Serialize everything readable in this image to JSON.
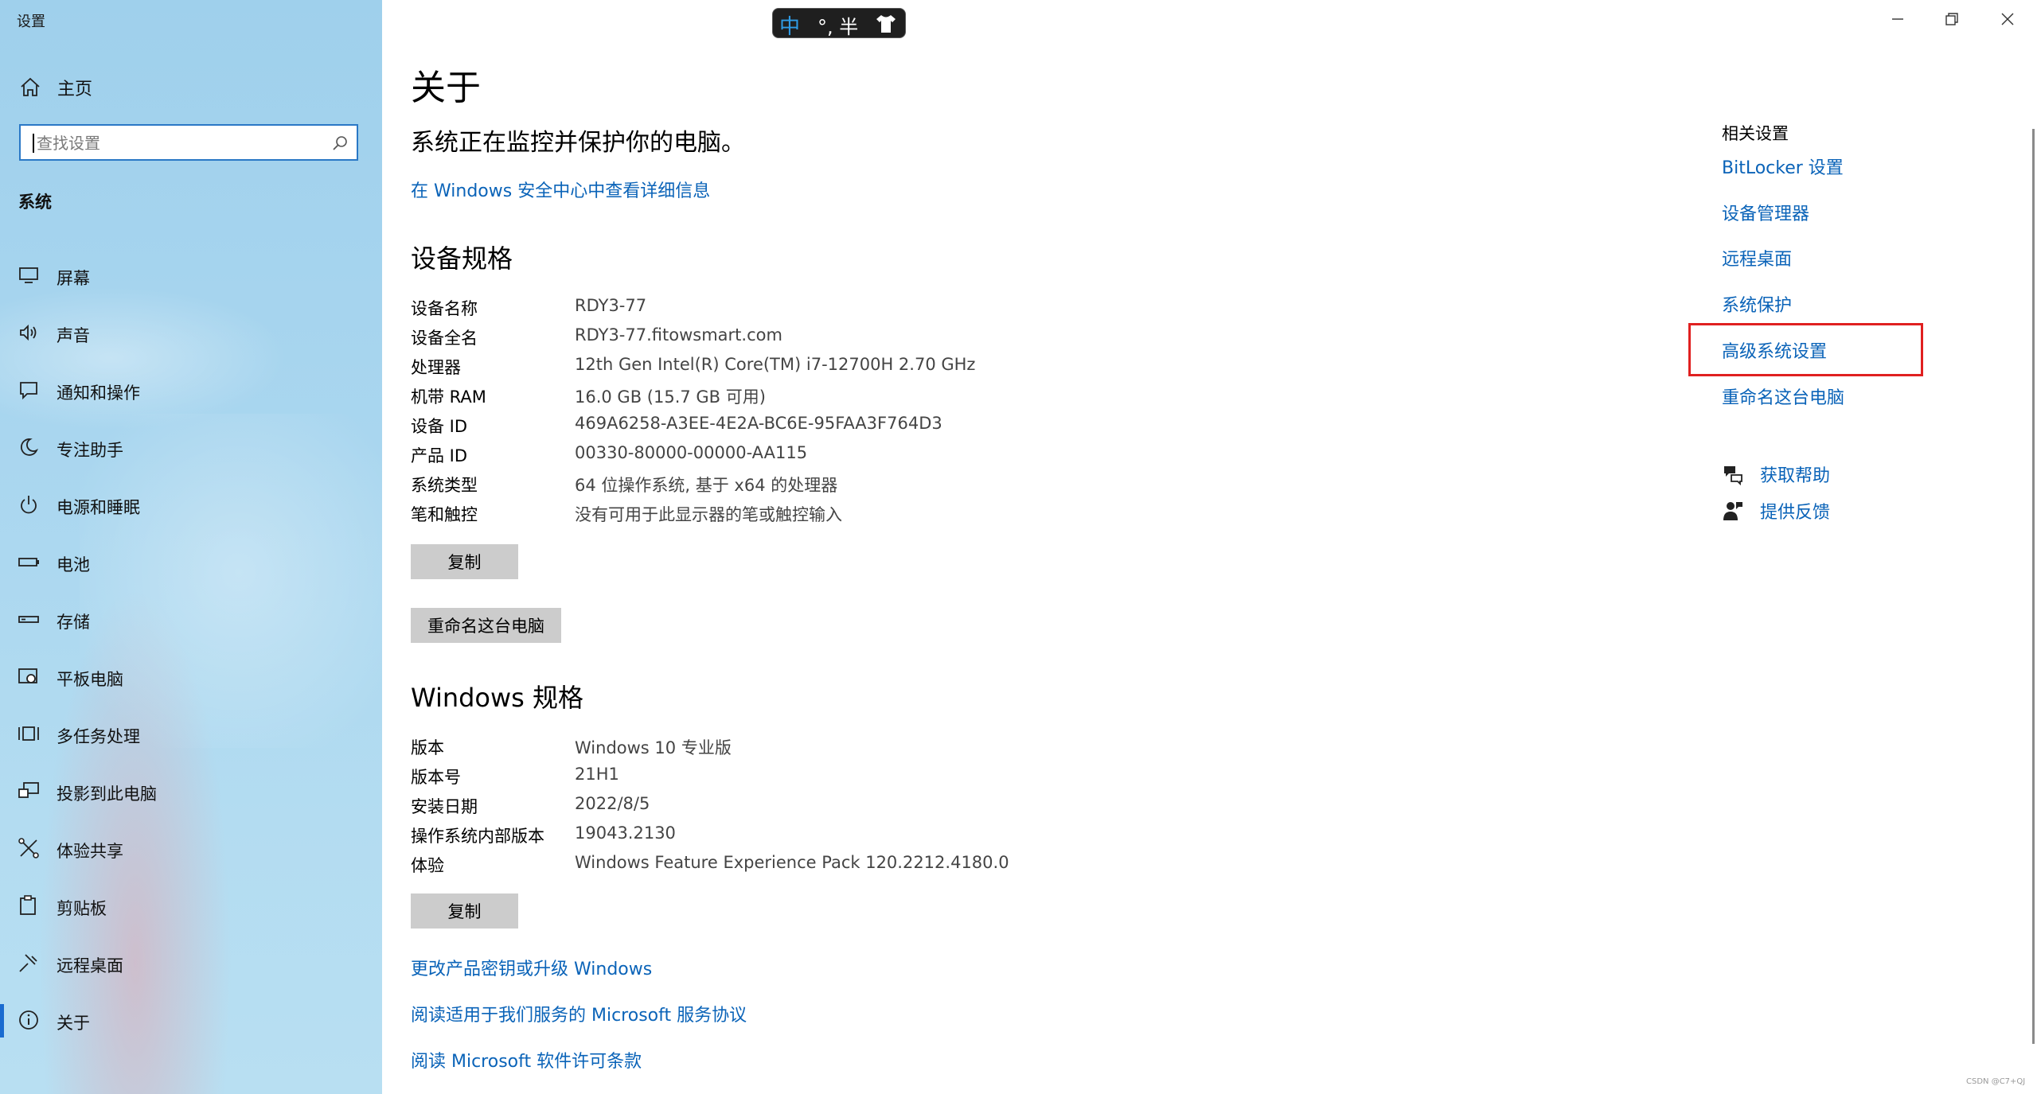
{
  "app_title": "设置",
  "sidebar": {
    "home_label": "主页",
    "search_placeholder": "查找设置",
    "section_title": "系统",
    "items": [
      {
        "label": "屏幕",
        "icon": "monitor-icon"
      },
      {
        "label": "声音",
        "icon": "speaker-icon"
      },
      {
        "label": "通知和操作",
        "icon": "notification-icon"
      },
      {
        "label": "专注助手",
        "icon": "moon-icon"
      },
      {
        "label": "电源和睡眠",
        "icon": "power-icon"
      },
      {
        "label": "电池",
        "icon": "battery-icon"
      },
      {
        "label": "存储",
        "icon": "storage-icon"
      },
      {
        "label": "平板电脑",
        "icon": "tablet-icon"
      },
      {
        "label": "多任务处理",
        "icon": "multitask-icon"
      },
      {
        "label": "投影到此电脑",
        "icon": "project-icon"
      },
      {
        "label": "体验共享",
        "icon": "share-icon"
      },
      {
        "label": "剪贴板",
        "icon": "clipboard-icon"
      },
      {
        "label": "远程桌面",
        "icon": "remote-desktop-icon"
      },
      {
        "label": "关于",
        "icon": "info-icon",
        "active": true
      }
    ]
  },
  "ime": {
    "mode": "中",
    "rest": "°, 半"
  },
  "main": {
    "title": "关于",
    "protect_text": "系统正在监控并保护你的电脑。",
    "security_link": "在 Windows 安全中心中查看详细信息",
    "device_specs_title": "设备规格",
    "device_specs": [
      {
        "key": "设备名称",
        "value": "RDY3-77"
      },
      {
        "key": "设备全名",
        "value": "RDY3-77.fitowsmart.com"
      },
      {
        "key": "处理器",
        "value": "12th Gen Intel(R) Core(TM) i7-12700H   2.70 GHz"
      },
      {
        "key": "机带 RAM",
        "value": "16.0 GB (15.7 GB 可用)"
      },
      {
        "key": "设备 ID",
        "value": "469A6258-A3EE-4E2A-BC6E-95FAA3F764D3"
      },
      {
        "key": "产品 ID",
        "value": "00330-80000-00000-AA115"
      },
      {
        "key": "系统类型",
        "value": "64 位操作系统, 基于 x64 的处理器"
      },
      {
        "key": "笔和触控",
        "value": "没有可用于此显示器的笔或触控输入"
      }
    ],
    "copy_label": "复制",
    "rename_label": "重命名这台电脑",
    "windows_specs_title": "Windows 规格",
    "windows_specs": [
      {
        "key": "版本",
        "value": "Windows 10 专业版"
      },
      {
        "key": "版本号",
        "value": "21H1"
      },
      {
        "key": "安装日期",
        "value": "2022/8/5"
      },
      {
        "key": "操作系统内部版本",
        "value": "19043.2130"
      },
      {
        "key": "体验",
        "value": "Windows Feature Experience Pack 120.2212.4180.0"
      }
    ],
    "copy2_label": "复制",
    "bottom_links": [
      "更改产品密钥或升级 Windows",
      "阅读适用于我们服务的 Microsoft 服务协议",
      "阅读 Microsoft 软件许可条款"
    ]
  },
  "related": {
    "title": "相关设置",
    "links": [
      "BitLocker 设置",
      "设备管理器",
      "远程桌面",
      "系统保护",
      "高级系统设置",
      "重命名这台电脑"
    ],
    "help": [
      {
        "label": "获取帮助",
        "icon": "help-chat-icon"
      },
      {
        "label": "提供反馈",
        "icon": "feedback-icon"
      }
    ]
  },
  "watermark": "CSDN @C7+QJ",
  "colors": {
    "accent": "#0a63b8",
    "highlight_box": "#e02020",
    "button_bg": "#cccccc"
  }
}
